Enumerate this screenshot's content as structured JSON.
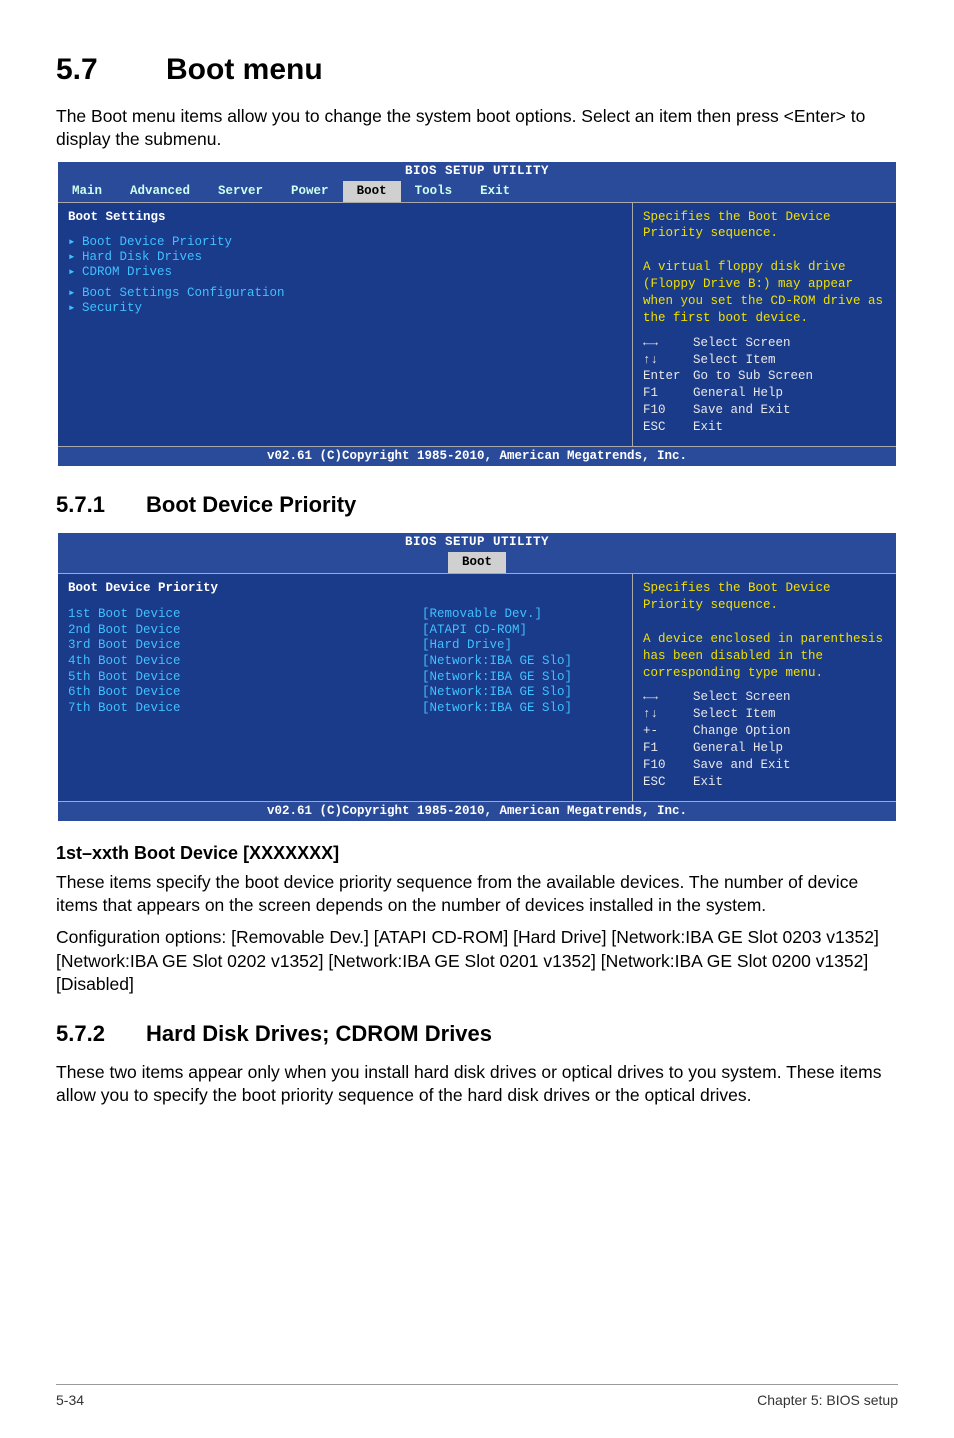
{
  "section": {
    "number": "5.7",
    "title": "Boot menu"
  },
  "intro": "The Boot menu items allow you to change the system boot options. Select an item then press <Enter> to display the submenu.",
  "bios1": {
    "title": "BIOS SETUP UTILITY",
    "menus": [
      "Main",
      "Advanced",
      "Server",
      "Power",
      "Boot",
      "Tools",
      "Exit"
    ],
    "active_menu_index": 4,
    "heading": "Boot Settings",
    "items": [
      "Boot Device Priority",
      "Hard Disk Drives",
      "CDROM Drives"
    ],
    "items2": [
      "Boot Settings Configuration",
      "Security"
    ],
    "help_top": "Specifies the Boot Device Priority sequence.\n\nA virtual floppy disk drive (Floppy Drive B:) may appear when you set the CD-ROM drive as the first boot device.",
    "help_bot": [
      {
        "k": "←→",
        "d": "Select Screen"
      },
      {
        "k": "↑↓",
        "d": "Select Item"
      },
      {
        "k": "Enter",
        "d": "Go to Sub Screen"
      },
      {
        "k": "F1",
        "d": "General Help"
      },
      {
        "k": "F10",
        "d": "Save and Exit"
      },
      {
        "k": "ESC",
        "d": "Exit"
      }
    ],
    "footer": "v02.61 (C)Copyright 1985-2010, American Megatrends, Inc."
  },
  "sub1": {
    "number": "5.7.1",
    "title": "Boot Device Priority"
  },
  "bios2": {
    "title": "BIOS SETUP UTILITY",
    "menus": [
      "Boot"
    ],
    "active_menu_index": 0,
    "heading": "Boot Device Priority",
    "options": [
      {
        "l": "1st Boot Device",
        "v": "[Removable Dev.]"
      },
      {
        "l": "2nd Boot Device",
        "v": "[ATAPI CD-ROM]"
      },
      {
        "l": "3rd Boot Device",
        "v": "[Hard Drive]"
      },
      {
        "l": "4th Boot Device",
        "v": "[Network:IBA GE Slo]"
      },
      {
        "l": "5th Boot Device",
        "v": "[Network:IBA GE Slo]"
      },
      {
        "l": "6th Boot Device",
        "v": "[Network:IBA GE Slo]"
      },
      {
        "l": "7th Boot Device",
        "v": "[Network:IBA GE Slo]"
      }
    ],
    "help_top": "Specifies the Boot Device Priority sequence.\n\nA device enclosed in parenthesis has been disabled in the corresponding type menu.",
    "help_bot": [
      {
        "k": "←→",
        "d": "Select Screen"
      },
      {
        "k": "↑↓",
        "d": "Select Item"
      },
      {
        "k": "+-",
        "d": "Change Option"
      },
      {
        "k": "F1",
        "d": "General Help"
      },
      {
        "k": "F10",
        "d": "Save and Exit"
      },
      {
        "k": "ESC",
        "d": "Exit"
      }
    ],
    "footer": "v02.61 (C)Copyright 1985-2010, American Megatrends, Inc."
  },
  "opt1": {
    "title": "1st–xxth Boot Device [XXXXXXX]",
    "p1": "These items specify the boot device priority sequence from the available devices. The number of device items that appears on the screen depends on the number of devices installed in the system.",
    "p2": "Configuration options: [Removable Dev.] [ATAPI CD-ROM] [Hard Drive] [Network:IBA GE Slot 0203 v1352] [Network:IBA GE Slot 0202 v1352] [Network:IBA GE Slot 0201 v1352] [Network:IBA GE Slot 0200 v1352] [Disabled]"
  },
  "sub2": {
    "number": "5.7.2",
    "title": "Hard Disk Drives; CDROM Drives"
  },
  "sub2_body": "These two items appear only when you install hard disk drives or optical drives to you system. These items allow you to specify the boot priority sequence of the hard disk drives or the optical drives.",
  "footer": {
    "left": "5-34",
    "right": "Chapter 5: BIOS setup"
  }
}
